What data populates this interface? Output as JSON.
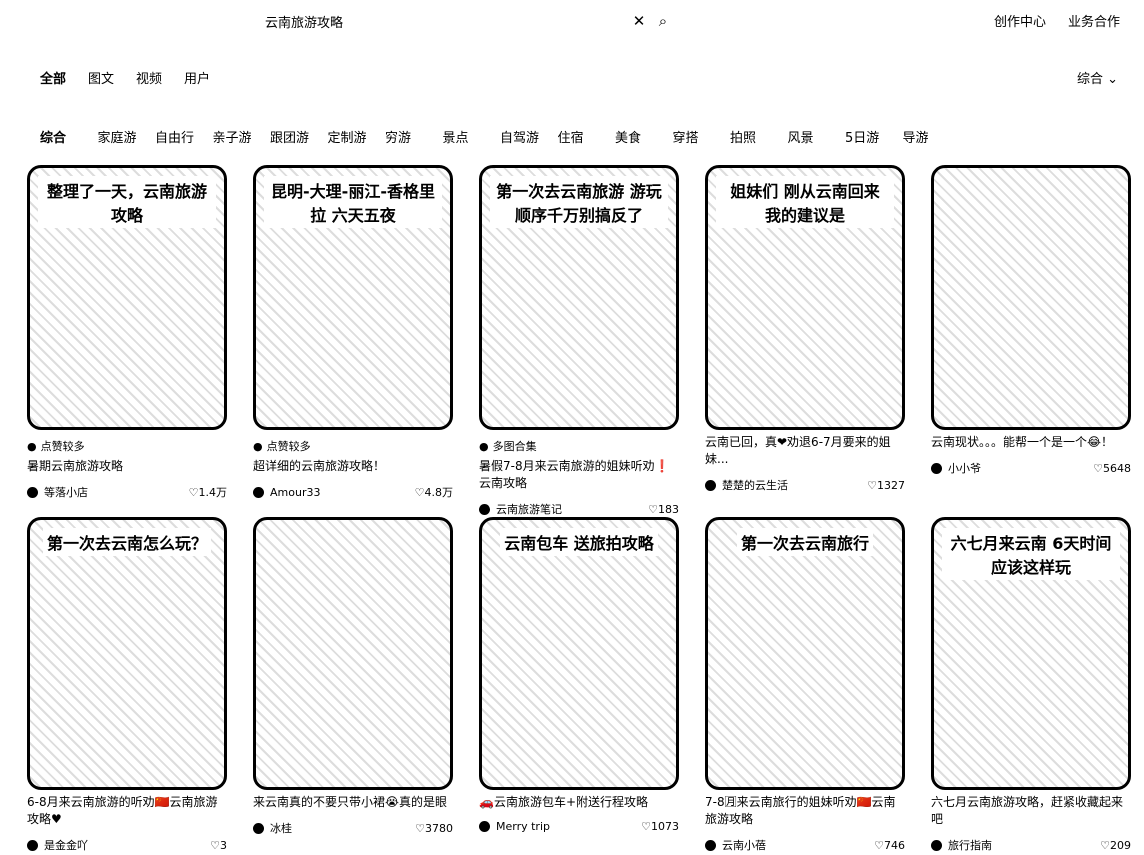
{
  "search": {
    "value": "云南旅游攻略",
    "clear_icon": "close-icon",
    "search_icon": "search-icon"
  },
  "top_links": [
    "创作中心",
    "业务合作"
  ],
  "types": [
    "全部",
    "图文",
    "视频",
    "用户"
  ],
  "sort": "综合",
  "tags": [
    "综合",
    "家庭游",
    "自由行",
    "亲子游",
    "跟团游",
    "定制游",
    "穷游",
    "景点",
    "自驾游",
    "住宿",
    "美食",
    "穿搭",
    "拍照",
    "风景",
    "5日游",
    "导游"
  ],
  "cards": [
    {
      "headline": "整理了一天，云南旅游攻略",
      "source": "点赞较多",
      "title": "暑期云南旅游攻略",
      "author": "等落小店",
      "likes": "1.4万"
    },
    {
      "headline": "昆明-大理-丽江-香格里拉 六天五夜",
      "source": "点赞较多",
      "title": "超详细的云南旅游攻略！",
      "author": "Amour33",
      "likes": "4.8万"
    },
    {
      "headline": "第一次去云南旅游 游玩顺序千万别搞反了",
      "source": "多图合集",
      "title": "暑假7-8月来云南旅游的姐妹听劝❗云南攻略",
      "author": "云南旅游笔记",
      "likes": "183"
    },
    {
      "headline": "姐妹们 刚从云南回来 我的建议是",
      "source": "",
      "title": "云南已回，真❤劝退6-7月要来的姐妹...",
      "author": "楚楚的云生活",
      "likes": "1327"
    },
    {
      "headline": "",
      "source": "",
      "title": "云南现状。。。能帮一个是一个😂！",
      "author": "小小爷",
      "likes": "5648"
    },
    {
      "headline": "第一次去云南怎么玩？",
      "source": "",
      "title": "6-8月来云南旅游的听劝🇨🇳云南旅游攻略♥",
      "author": "是金金吖",
      "likes": "3"
    },
    {
      "headline": "",
      "source": "",
      "title": "来云南真的不要只带小裙😭真的是眼",
      "author": "冰桂",
      "likes": "3780"
    },
    {
      "headline": "云南包车 送旅拍攻略",
      "source": "",
      "title": "🚗云南旅游包车+附送行程攻略",
      "author": "Merry trip",
      "likes": "1073"
    },
    {
      "headline": "第一次去云南旅行",
      "source": "",
      "title": "7-8🈷来云南旅行的姐妹听劝🇨🇳云南旅游攻略",
      "author": "云南小蓓",
      "likes": "746"
    },
    {
      "headline": "六七月来云南 6天时间 应该这样玩",
      "source": "",
      "title": "六七月云南旅游攻略，赶紧收藏起来吧",
      "author": "旅行指南",
      "likes": "209"
    }
  ]
}
